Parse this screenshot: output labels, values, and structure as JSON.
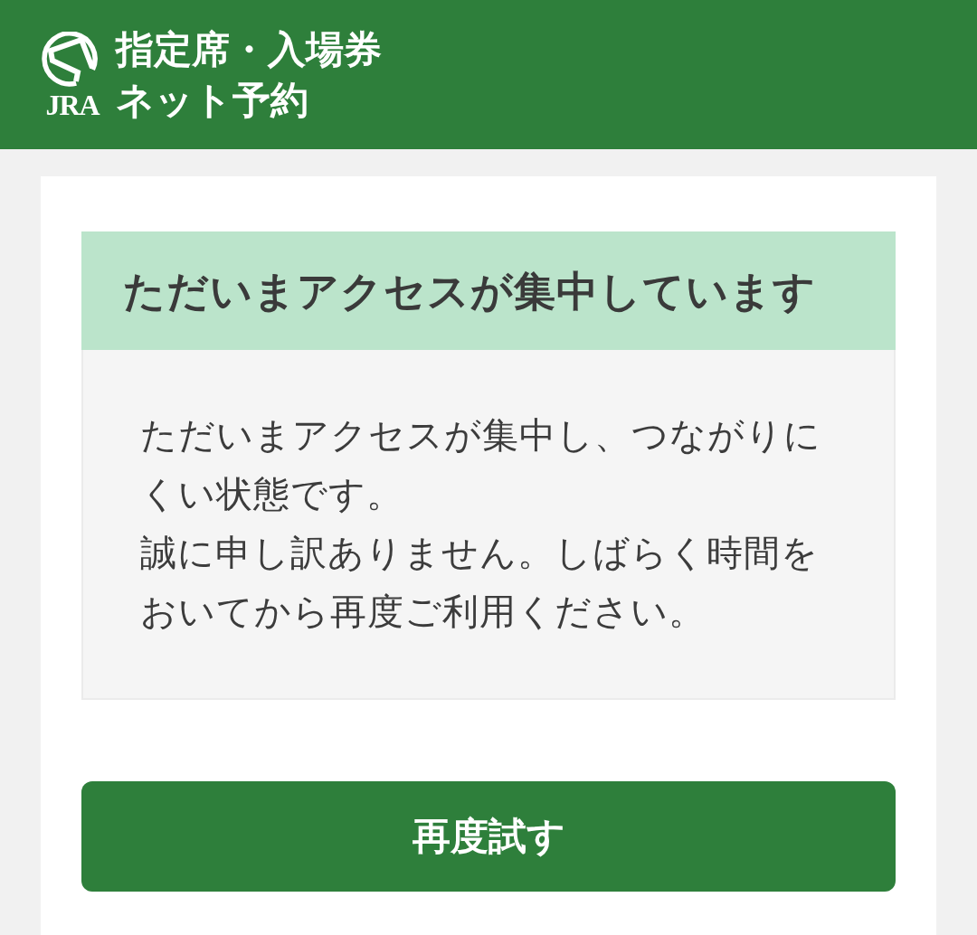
{
  "header": {
    "logo_text": "JRA",
    "title_lines": [
      "指定席・入場券",
      "ネット予約"
    ]
  },
  "notice": {
    "heading": "ただいまアクセスが集中しています",
    "paragraphs": [
      "ただいまアクセスが集中し、つながりにくい状態です。",
      "誠に申し訳ありません。しばらく時間をおいてから再度ご利用ください。"
    ]
  },
  "retry_button": {
    "label": "再度試す"
  }
}
